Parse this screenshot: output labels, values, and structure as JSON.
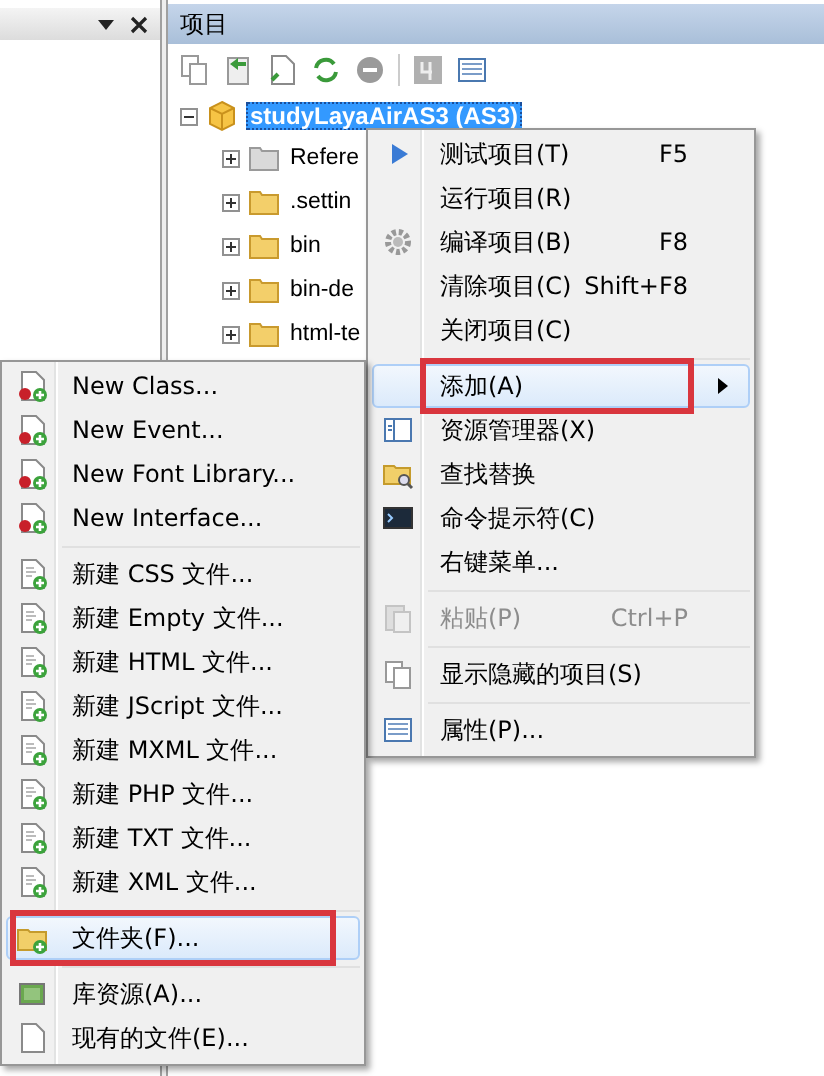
{
  "project_panel": {
    "title": "项目",
    "tree": {
      "label": "studyLayaAirAS3 (AS3)",
      "selected": true,
      "expanded": true,
      "children": [
        {
          "label": "Refere",
          "kind": "references",
          "expanded": false
        },
        {
          "label": ".settin",
          "kind": "folder",
          "expanded": false
        },
        {
          "label": "bin",
          "kind": "folder",
          "expanded": false
        },
        {
          "label": "bin-de",
          "kind": "folder",
          "expanded": false
        },
        {
          "label": "html-te",
          "kind": "folder",
          "expanded": false
        }
      ]
    }
  },
  "context_menu": {
    "items": [
      {
        "kind": "item",
        "label": "测试项目(T)",
        "shortcut": "F5",
        "highlighted": false,
        "disabled": false,
        "annotated": false
      },
      {
        "kind": "item",
        "label": "运行项目(R)",
        "highlighted": false,
        "disabled": false,
        "annotated": false
      },
      {
        "kind": "item",
        "label": "编译项目(B)",
        "shortcut": "F8",
        "highlighted": false,
        "disabled": false,
        "annotated": false
      },
      {
        "kind": "item",
        "label": "清除项目(C)",
        "shortcut": "Shift+F8",
        "highlighted": false,
        "disabled": false,
        "annotated": false
      },
      {
        "kind": "item",
        "label": "关闭项目(C)",
        "highlighted": false,
        "disabled": false,
        "annotated": false
      },
      {
        "kind": "separator"
      },
      {
        "kind": "submenu",
        "label": "添加(A)",
        "highlighted": true,
        "disabled": false,
        "annotated": true
      },
      {
        "kind": "item",
        "label": "资源管理器(X)",
        "highlighted": false,
        "disabled": false,
        "annotated": false
      },
      {
        "kind": "item",
        "label": "查找替换",
        "highlighted": false,
        "disabled": false,
        "annotated": false
      },
      {
        "kind": "item",
        "label": "命令提示符(C)",
        "highlighted": false,
        "disabled": false,
        "annotated": false
      },
      {
        "kind": "item",
        "label": "右键菜单...",
        "highlighted": false,
        "disabled": false,
        "annotated": false
      },
      {
        "kind": "separator"
      },
      {
        "kind": "item",
        "label": "粘贴(P)",
        "shortcut": "Ctrl+P",
        "highlighted": false,
        "disabled": true,
        "annotated": false
      },
      {
        "kind": "separator"
      },
      {
        "kind": "item",
        "label": "显示隐藏的项目(S)",
        "highlighted": false,
        "disabled": false,
        "annotated": false
      },
      {
        "kind": "separator"
      },
      {
        "kind": "item",
        "label": "属性(P)...",
        "highlighted": false,
        "disabled": false,
        "annotated": false
      }
    ]
  },
  "add_submenu": {
    "items": [
      {
        "kind": "item",
        "label": "New Class...",
        "highlighted": false,
        "disabled": false,
        "annotated": false
      },
      {
        "kind": "item",
        "label": "New Event...",
        "highlighted": false,
        "disabled": false,
        "annotated": false
      },
      {
        "kind": "item",
        "label": "New Font Library...",
        "highlighted": false,
        "disabled": false,
        "annotated": false
      },
      {
        "kind": "item",
        "label": "New Interface...",
        "highlighted": false,
        "disabled": false,
        "annotated": false
      },
      {
        "kind": "separator"
      },
      {
        "kind": "item",
        "label": "新建 CSS 文件...",
        "highlighted": false,
        "disabled": false,
        "annotated": false
      },
      {
        "kind": "item",
        "label": "新建 Empty 文件...",
        "highlighted": false,
        "disabled": false,
        "annotated": false
      },
      {
        "kind": "item",
        "label": "新建 HTML 文件...",
        "highlighted": false,
        "disabled": false,
        "annotated": false
      },
      {
        "kind": "item",
        "label": "新建 JScript 文件...",
        "highlighted": false,
        "disabled": false,
        "annotated": false
      },
      {
        "kind": "item",
        "label": "新建 MXML 文件...",
        "highlighted": false,
        "disabled": false,
        "annotated": false
      },
      {
        "kind": "item",
        "label": "新建 PHP 文件...",
        "highlighted": false,
        "disabled": false,
        "annotated": false
      },
      {
        "kind": "item",
        "label": "新建 TXT 文件...",
        "highlighted": false,
        "disabled": false,
        "annotated": false
      },
      {
        "kind": "item",
        "label": "新建 XML 文件...",
        "highlighted": false,
        "disabled": false,
        "annotated": false
      },
      {
        "kind": "separator"
      },
      {
        "kind": "item",
        "label": "文件夹(F)...",
        "highlighted": true,
        "disabled": false,
        "annotated": true
      },
      {
        "kind": "separator"
      },
      {
        "kind": "item",
        "label": "库资源(A)...",
        "highlighted": false,
        "disabled": false,
        "annotated": false
      },
      {
        "kind": "item",
        "label": "现有的文件(E)...",
        "highlighted": false,
        "disabled": false,
        "annotated": false
      }
    ]
  }
}
